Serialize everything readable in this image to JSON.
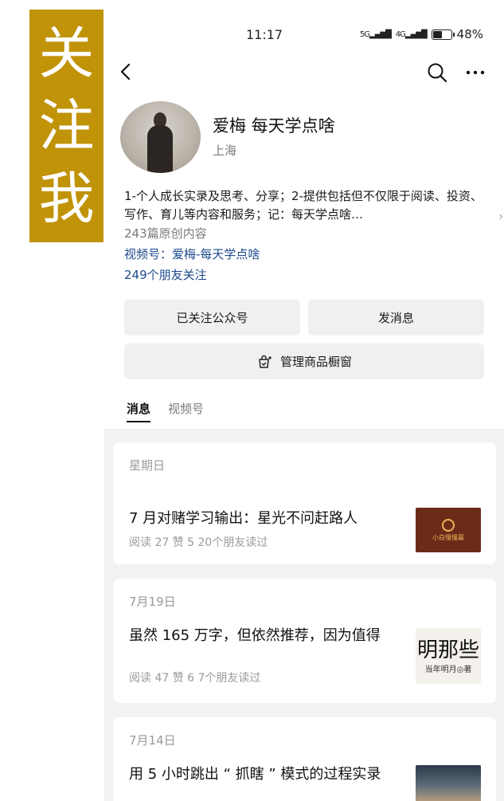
{
  "banner": {
    "chars": [
      "关",
      "注",
      "我"
    ]
  },
  "status": {
    "time": "11:17",
    "signal1": "5G",
    "signal2": "4G",
    "battery": "48%",
    "battery_level": 0.48
  },
  "profile": {
    "name": "爱梅 每天学点啥",
    "location": "上海",
    "description": "1-个人成长实录及思考、分享；2-提供包括但不仅限于阅读、投资、写作、育儿等内容和服务；记：每天学点啥…",
    "articles": "243篇原创内容",
    "video_channel": "视频号：爱梅-每天学点啥",
    "friends_following": "249个朋友关注"
  },
  "actions": {
    "follow": "已关注公众号",
    "message": "发消息",
    "shop": "管理商品橱窗"
  },
  "tabs": [
    {
      "label": "消息",
      "active": true
    },
    {
      "label": "视频号",
      "active": false
    }
  ],
  "posts": [
    {
      "date": "星期日",
      "title": "7 月对赌学习输出：星光不问赶路人",
      "meta": "阅读 27   赞 5   20个朋友读过",
      "thumb_text": "小白慢慢赢"
    },
    {
      "date": "7月19日",
      "title": "虽然 165 万字，但依然推荐，因为值得",
      "meta": "阅读 47   赞 6   7个朋友读过",
      "thumb_big": "明那些",
      "thumb_small": "当年明月◎著"
    },
    {
      "date": "7月14日",
      "title": "用 5 小时跳出 “ 抓瞎 ” 模式的过程实录"
    }
  ]
}
